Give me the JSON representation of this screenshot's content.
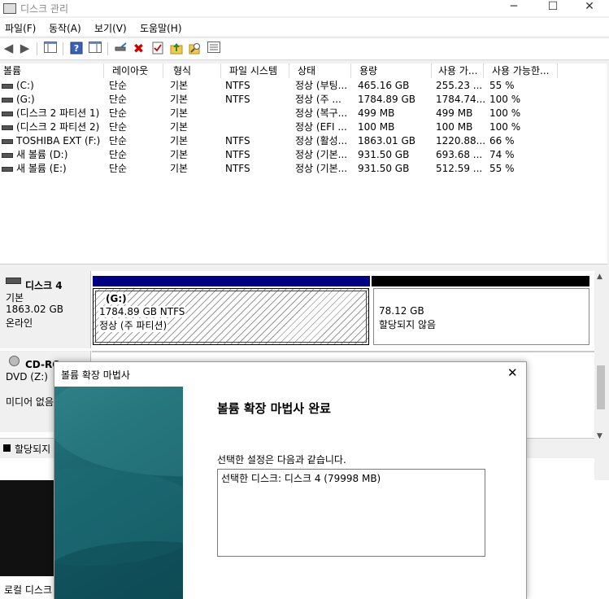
{
  "window": {
    "title": "디스크 관리",
    "controls": [
      "─",
      "☐",
      "✕"
    ]
  },
  "menu": [
    "파일(F)",
    "동작(A)",
    "보기(V)",
    "도움말(H)"
  ],
  "columns": [
    "볼륨",
    "레이아웃",
    "형식",
    "파일 시스템",
    "상태",
    "용량",
    "사용 가...",
    "사용 가능한..."
  ],
  "volumes": [
    {
      "name": "(C:)",
      "layout": "단순",
      "type": "기본",
      "fs": "NTFS",
      "status": "정상 (부팅...",
      "capacity": "465.16 GB",
      "free": "255.23 ...",
      "pct": "55 %"
    },
    {
      "name": "(G:)",
      "layout": "단순",
      "type": "기본",
      "fs": "NTFS",
      "status": "정상 (주 ...",
      "capacity": "1784.89 GB",
      "free": "1784.74...",
      "pct": "100 %"
    },
    {
      "name": "(디스크 2 파티션 1)",
      "layout": "단순",
      "type": "기본",
      "fs": "",
      "status": "정상 (복구...",
      "capacity": "499 MB",
      "free": "499 MB",
      "pct": "100 %"
    },
    {
      "name": "(디스크 2 파티션 2)",
      "layout": "단순",
      "type": "기본",
      "fs": "",
      "status": "정상 (EFI ...",
      "capacity": "100 MB",
      "free": "100 MB",
      "pct": "100 %"
    },
    {
      "name": "TOSHIBA EXT (F:)",
      "layout": "단순",
      "type": "기본",
      "fs": "NTFS",
      "status": "정상 (활성...",
      "capacity": "1863.01 GB",
      "free": "1220.88...",
      "pct": "66 %"
    },
    {
      "name": "새 볼륨 (D:)",
      "layout": "단순",
      "type": "기본",
      "fs": "NTFS",
      "status": "정상 (기본...",
      "capacity": "931.50 GB",
      "free": "693.68 ...",
      "pct": "74 %"
    },
    {
      "name": "새 볼륨 (E:)",
      "layout": "단순",
      "type": "기본",
      "fs": "NTFS",
      "status": "정상 (기본...",
      "capacity": "931.50 GB",
      "free": "512.59 ...",
      "pct": "55 %"
    }
  ],
  "disk4": {
    "name": "디스크 4",
    "type": "기본",
    "size": "1863.02 GB",
    "state": "온라인",
    "partition": {
      "label": "(G:)",
      "size": "1784.89 GB NTFS",
      "status": "정상 (주 파티션)"
    },
    "unallocated": {
      "size": "78.12 GB",
      "status": "할당되지 않음"
    }
  },
  "cdrom": {
    "name": "CD-RO",
    "drive": "DVD (Z:)",
    "media": "미디어 없음"
  },
  "legend": {
    "unallocated": "할당되지"
  },
  "bottom_label": "로컬 디스크",
  "wizard": {
    "title": "볼륨 확장 마법사",
    "heading": "볼륨 확장 마법사 완료",
    "subtitle": "선택한 설정은 다음과 같습니다.",
    "settings_text": "선택한 디스크: 디스크 4 (79998 MB)",
    "close": "✕"
  },
  "colors": {
    "primary_bar": "#000080",
    "unallocated_bar": "#000000",
    "banner": "#175f68"
  }
}
